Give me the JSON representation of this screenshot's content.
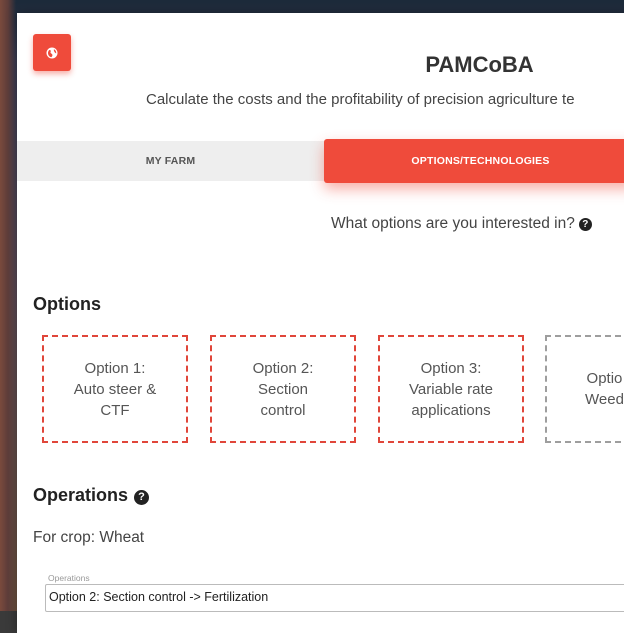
{
  "app": {
    "title": "PAMCoBA",
    "subtitle": "Calculate the costs and the profitability of precision agriculture te",
    "logo_icon": "globe-icon",
    "accent": "#ef4b3b"
  },
  "tabs": [
    {
      "label": "MY FARM",
      "active": false
    },
    {
      "label": "OPTIONS/TECHNOLOGIES",
      "active": true
    }
  ],
  "question": {
    "text": "What options are you interested in?",
    "icon": "question-circle-icon"
  },
  "options_section": {
    "heading": "Options",
    "items": [
      {
        "label": "Option 1:\nAuto steer &\nCTF",
        "border": "#e0463a"
      },
      {
        "label": "Option 2:\nSection\ncontrol",
        "border": "#e0463a"
      },
      {
        "label": "Option 3:\nVariable rate\napplications",
        "border": "#e0463a"
      },
      {
        "label": "Optio\nWeed",
        "border": "#9e9e9e"
      }
    ]
  },
  "operations_section": {
    "heading": "Operations",
    "heading_icon": "question-circle-icon",
    "crop_text": "For crop: Wheat",
    "field_label": "Operations",
    "field_value": "Option 2: Section control -> Fertilization"
  }
}
